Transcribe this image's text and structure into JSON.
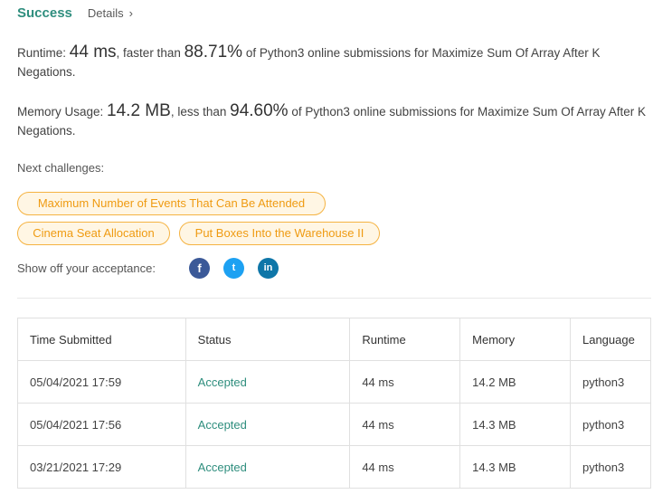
{
  "header": {
    "status": "Success",
    "details_label": "Details",
    "details_chevron": "›"
  },
  "runtime": {
    "label": "Runtime:",
    "value": "44 ms",
    "comparison_text": ", faster than",
    "percent": "88.71%",
    "suffix": "of Python3 online submissions for Maximize Sum Of Array After K Negations."
  },
  "memory": {
    "label": "Memory Usage:",
    "value": "14.2 MB",
    "comparison_text": ", less than",
    "percent": "94.60%",
    "suffix": "of Python3 online submissions for Maximize Sum Of Array After K Negations."
  },
  "next": {
    "label": "Next challenges:",
    "challenges": [
      "Maximum Number of Events That Can Be Attended",
      "Cinema Seat Allocation",
      "Put Boxes Into the Warehouse II"
    ]
  },
  "share": {
    "label": "Show off your acceptance:",
    "icons": [
      "facebook-icon",
      "twitter-icon",
      "linkedin-icon"
    ],
    "glyphs": [
      "f",
      "t",
      "in"
    ]
  },
  "colors": {
    "accent": "#2f8e7e",
    "chip_border": "#f5b342",
    "chip_text": "#ef9b12",
    "chip_bg": "#fff6e4"
  },
  "table": {
    "headers": [
      "Time Submitted",
      "Status",
      "Runtime",
      "Memory",
      "Language"
    ],
    "rows": [
      [
        "05/04/2021 17:59",
        "Accepted",
        "44 ms",
        "14.2 MB",
        "python3"
      ],
      [
        "05/04/2021 17:56",
        "Accepted",
        "44 ms",
        "14.3 MB",
        "python3"
      ],
      [
        "03/21/2021 17:29",
        "Accepted",
        "44 ms",
        "14.3 MB",
        "python3"
      ]
    ]
  }
}
